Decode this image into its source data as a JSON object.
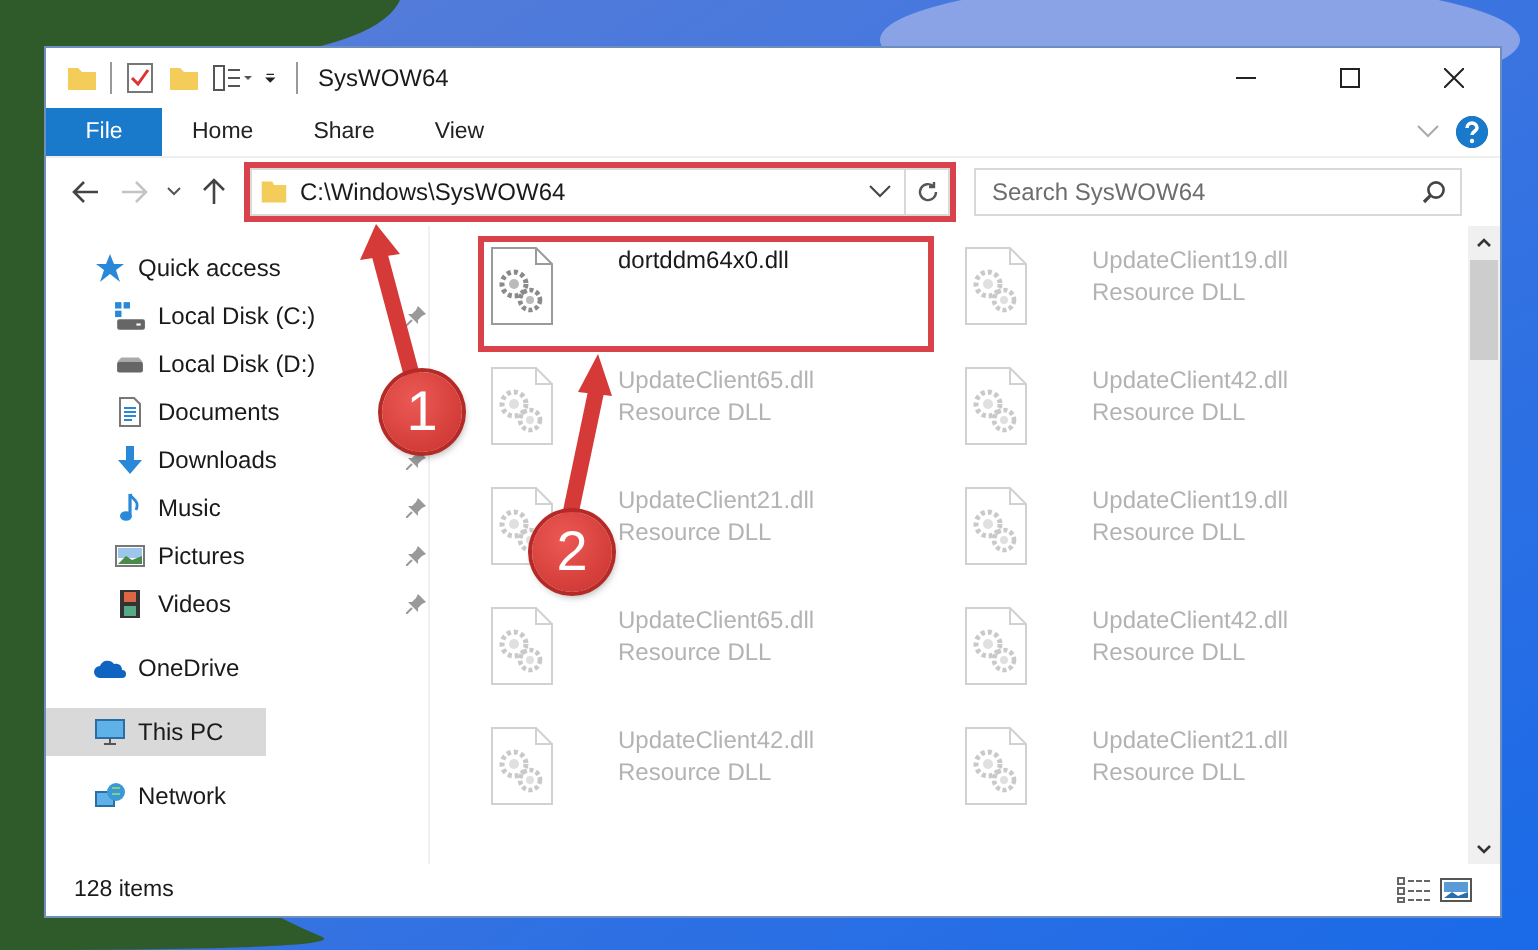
{
  "window": {
    "title": "SysWOW64"
  },
  "ribbon": {
    "tabs": [
      {
        "label": "File",
        "kind": "file"
      },
      {
        "label": "Home",
        "kind": "tab"
      },
      {
        "label": "Share",
        "kind": "tab"
      },
      {
        "label": "View",
        "kind": "tab"
      }
    ]
  },
  "address_bar": {
    "path": "C:\\Windows\\SysWOW64",
    "highlighted": true
  },
  "search": {
    "placeholder": "Search SysWOW64"
  },
  "navigation": {
    "disabled_forward": true
  },
  "sidebar": {
    "items": [
      {
        "label": "Quick access",
        "kind": "quick",
        "selected": false,
        "children": [
          {
            "label": "Local Disk (C:)",
            "kind": "drive-windows",
            "pinned": true
          },
          {
            "label": "Local Disk (D:)",
            "kind": "drive"
          },
          {
            "label": "Documents",
            "kind": "documents"
          },
          {
            "label": "Downloads",
            "kind": "downloads",
            "pinned": true
          },
          {
            "label": "Music",
            "kind": "music",
            "pinned": true
          },
          {
            "label": "Pictures",
            "kind": "pictures",
            "pinned": true
          },
          {
            "label": "Videos",
            "kind": "videos",
            "pinned": true
          }
        ]
      },
      {
        "label": "OneDrive",
        "kind": "onedrive",
        "selected": false
      },
      {
        "label": "This PC",
        "kind": "pc",
        "selected": true
      },
      {
        "label": "Network",
        "kind": "network",
        "selected": false
      }
    ]
  },
  "files": [
    {
      "name": "dortddm64x0.dll",
      "dimmed": false,
      "highlighted": true
    },
    {
      "name": "UpdateClient19.dll",
      "type": "Resource DLL",
      "dimmed": true
    },
    {
      "name": "UpdateClient65.dll",
      "type": "Resource DLL",
      "dimmed": true
    },
    {
      "name": "UpdateClient42.dll",
      "type": "Resource DLL",
      "dimmed": true
    },
    {
      "name": "UpdateClient21.dll",
      "type": "Resource DLL",
      "dimmed": true
    },
    {
      "name": "UpdateClient19.dll",
      "type": "Resource DLL",
      "dimmed": true
    },
    {
      "name": "UpdateClient65.dll",
      "type": "Resource DLL",
      "dimmed": true
    },
    {
      "name": "UpdateClient42.dll",
      "type": "Resource DLL",
      "dimmed": true
    },
    {
      "name": "UpdateClient42.dll",
      "type": "Resource DLL",
      "dimmed": true
    },
    {
      "name": "UpdateClient21.dll",
      "type": "Resource DLL",
      "dimmed": true
    }
  ],
  "status_bar": {
    "count": "128 items"
  },
  "annotations": [
    {
      "label": "1"
    },
    {
      "label": "2"
    }
  ]
}
